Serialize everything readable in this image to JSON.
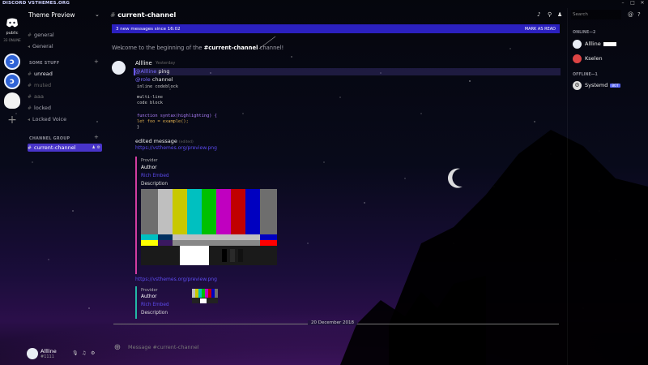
{
  "window": {
    "brand": "DISCORD VSTHEMES.ORG",
    "controls": [
      "–",
      "□",
      "✕"
    ]
  },
  "guilds": {
    "home_label": "public",
    "home_count": "33 ONLINE",
    "items": [
      {
        "icon": "vsthemes-server-icon"
      },
      {
        "icon": "vsthemes-server-icon"
      },
      {
        "icon": "ghost-server-icon"
      }
    ]
  },
  "sidebar": {
    "server_name": "Theme Preview",
    "channels": [
      {
        "label": "general"
      },
      {
        "label": "General"
      }
    ],
    "category1": "SOME STUFF",
    "channels2": [
      {
        "label": "unread"
      },
      {
        "label": "muted"
      },
      {
        "label": "aaa"
      },
      {
        "label": "locked"
      },
      {
        "label": "Locked Voice"
      }
    ],
    "category2": "CHANNEL GROUP",
    "active_channel": "current-channel"
  },
  "user_panel": {
    "name": "Allline",
    "tag": "#1111"
  },
  "header": {
    "channel": "current-channel"
  },
  "banner": {
    "text": "3 new messages since 16:02",
    "action": "MARK AS READ"
  },
  "welcome": {
    "prefix": "Welcome to the beginning of the ",
    "channel": "#current-channel",
    "suffix": " channel!"
  },
  "message": {
    "author": "Allline",
    "timestamp": "Yesterday",
    "mention_tag": "@Allline",
    "mention_text": " ping",
    "role_tag": "@role",
    "role_text": " channel",
    "code_inline": "inline codeblock",
    "code_lines": [
      "multi-line",
      "code block",
      "",
      "function syntax(highlighting) {",
      "    let foo = example();",
      "}"
    ],
    "edited_text": "edited message",
    "edited_tag": "(edited)",
    "link1": "https://vsthemes.org/preview.png",
    "embed1": {
      "provider": "Provider",
      "author": "Author",
      "title": "Rich Embed",
      "description": "Description"
    },
    "link2": "https://vsthemes.org/preview.png",
    "embed2": {
      "provider": "Provider",
      "author": "Author",
      "title": "Rich Embed",
      "description": "Description"
    }
  },
  "date_divider": "20 December 2018",
  "composer": {
    "placeholder": "Message #current-channel"
  },
  "members": {
    "search_placeholder": "Search",
    "online_header": "ONLINE—2",
    "online": [
      {
        "name": "Allline"
      },
      {
        "name": "Kselen"
      }
    ],
    "offline_header": "OFFLINE—1",
    "offline": [
      {
        "name": "Systemd",
        "badge": "BOT"
      }
    ]
  },
  "colors": {
    "accent": "#4834c9",
    "link": "#5d4bf0",
    "embed_border": "#d13ca0"
  }
}
